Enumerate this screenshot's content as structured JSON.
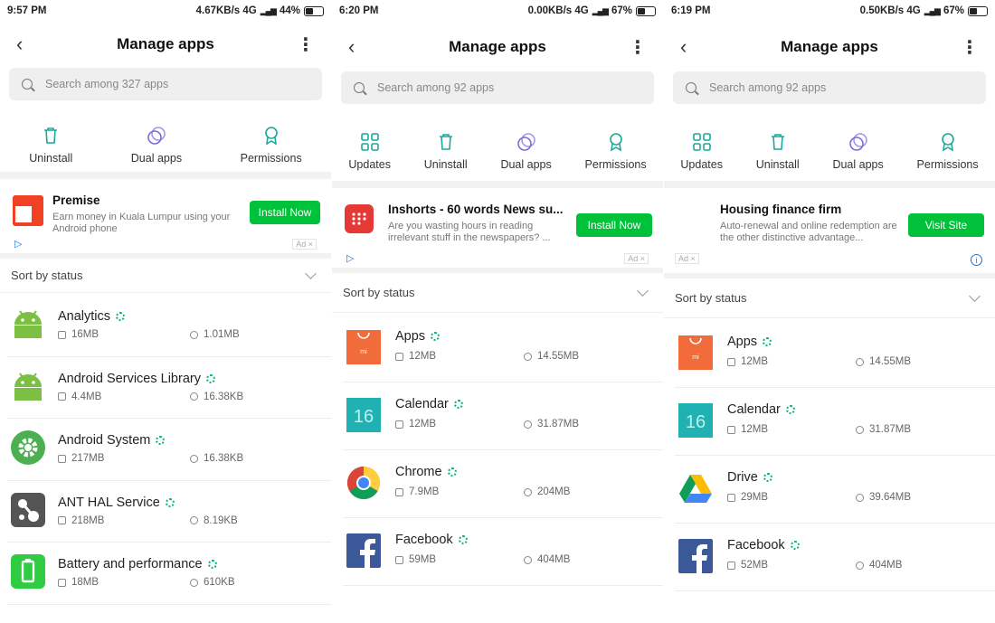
{
  "screens": [
    {
      "status": {
        "time": "9:57 PM",
        "right": "4.67KB/s  4G",
        "battery": "44%"
      },
      "header": {
        "title": "Manage apps",
        "back": "‹",
        "more": "⋮"
      },
      "search": {
        "placeholder": "Search among 327 apps"
      },
      "actions": [
        {
          "label": "Uninstall",
          "icon": "trash-icon"
        },
        {
          "label": "Dual apps",
          "icon": "dual-icon"
        },
        {
          "label": "Permissions",
          "icon": "badge-icon"
        }
      ],
      "ad": {
        "title": "Premise",
        "desc": "Earn money in Kuala Lumpur using your Android phone",
        "button": "Install Now",
        "tag": "Ad ×"
      },
      "sort": "Sort by status",
      "apps": [
        {
          "name": "Analytics",
          "storage": "16MB",
          "cache": "1.01MB",
          "icon": "android-icon"
        },
        {
          "name": "Android Services Library",
          "storage": "4.4MB",
          "cache": "16.38KB",
          "icon": "android-icon"
        },
        {
          "name": "Android System",
          "storage": "217MB",
          "cache": "16.38KB",
          "icon": "gear-icon"
        },
        {
          "name": "ANT HAL Service",
          "storage": "218MB",
          "cache": "8.19KB",
          "icon": "ant-icon"
        },
        {
          "name": "Battery and performance",
          "storage": "18MB",
          "cache": "610KB",
          "icon": "battery-icon"
        }
      ]
    },
    {
      "status": {
        "time": "6:20 PM",
        "right": "0.00KB/s  4G",
        "battery": "67%"
      },
      "header": {
        "title": "Manage apps",
        "back": "‹",
        "more": "⋮"
      },
      "search": {
        "placeholder": "Search among 92 apps"
      },
      "actions": [
        {
          "label": "Updates",
          "icon": "updates-icon"
        },
        {
          "label": "Uninstall",
          "icon": "trash-icon"
        },
        {
          "label": "Dual apps",
          "icon": "dual-icon"
        },
        {
          "label": "Permissions",
          "icon": "badge-icon"
        }
      ],
      "ad": {
        "title": "Inshorts - 60 words News su...",
        "desc": "Are you wasting hours in reading irrelevant stuff in the newspapers? ...",
        "button": "Install Now",
        "tag": "Ad ×"
      },
      "sort": "Sort by status",
      "apps": [
        {
          "name": "Apps",
          "storage": "12MB",
          "cache": "14.55MB",
          "icon": "mi-apps-icon"
        },
        {
          "name": "Calendar",
          "storage": "12MB",
          "cache": "31.87MB",
          "icon": "calendar-icon",
          "day": "16"
        },
        {
          "name": "Chrome",
          "storage": "7.9MB",
          "cache": "204MB",
          "icon": "chrome-icon"
        },
        {
          "name": "Facebook",
          "storage": "59MB",
          "cache": "404MB",
          "icon": "facebook-icon"
        }
      ]
    },
    {
      "status": {
        "time": "6:19 PM",
        "right": "0.50KB/s  4G",
        "battery": "67%"
      },
      "header": {
        "title": "Manage apps",
        "back": "‹",
        "more": "⋮"
      },
      "search": {
        "placeholder": "Search among 92 apps"
      },
      "actions": [
        {
          "label": "Updates",
          "icon": "updates-icon"
        },
        {
          "label": "Uninstall",
          "icon": "trash-icon"
        },
        {
          "label": "Dual apps",
          "icon": "dual-icon"
        },
        {
          "label": "Permissions",
          "icon": "badge-icon"
        }
      ],
      "ad": {
        "title": "Housing finance firm",
        "desc": "Auto-renewal and online redemption are the other distinctive advantage...",
        "button": "Visit Site",
        "tag": "Ad ×"
      },
      "sort": "Sort by status",
      "apps": [
        {
          "name": "Apps",
          "storage": "12MB",
          "cache": "14.55MB",
          "icon": "mi-apps-icon"
        },
        {
          "name": "Calendar",
          "storage": "12MB",
          "cache": "31.87MB",
          "icon": "calendar-icon",
          "day": "16"
        },
        {
          "name": "Drive",
          "storage": "29MB",
          "cache": "39.64MB",
          "icon": "drive-icon"
        },
        {
          "name": "Facebook",
          "storage": "52MB",
          "cache": "404MB",
          "icon": "facebook-icon"
        }
      ]
    }
  ]
}
